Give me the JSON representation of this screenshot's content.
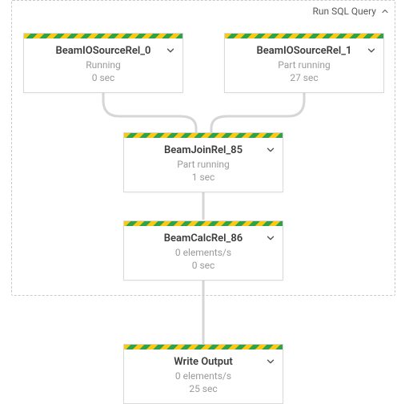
{
  "group": {
    "label": "Run SQL Query"
  },
  "nodes": {
    "src0": {
      "title": "BeamIOSourceRel_0",
      "status": "Running",
      "timing": "0 sec"
    },
    "src1": {
      "title": "BeamIOSourceRel_1",
      "status": "Part running",
      "timing": "27 sec"
    },
    "join": {
      "title": "BeamJoinRel_85",
      "status": "Part running",
      "timing": "1 sec"
    },
    "calc": {
      "title": "BeamCalcRel_86",
      "status": "0 elements/s",
      "timing": "0 sec"
    },
    "write": {
      "title": "Write Output",
      "status": "0 elements/s",
      "timing": "25 sec"
    }
  },
  "colors": {
    "stripe_a": "#f9c915",
    "stripe_b": "#2fa24a",
    "edge": "#d6d6d6",
    "group_border": "#c9c9c9"
  }
}
